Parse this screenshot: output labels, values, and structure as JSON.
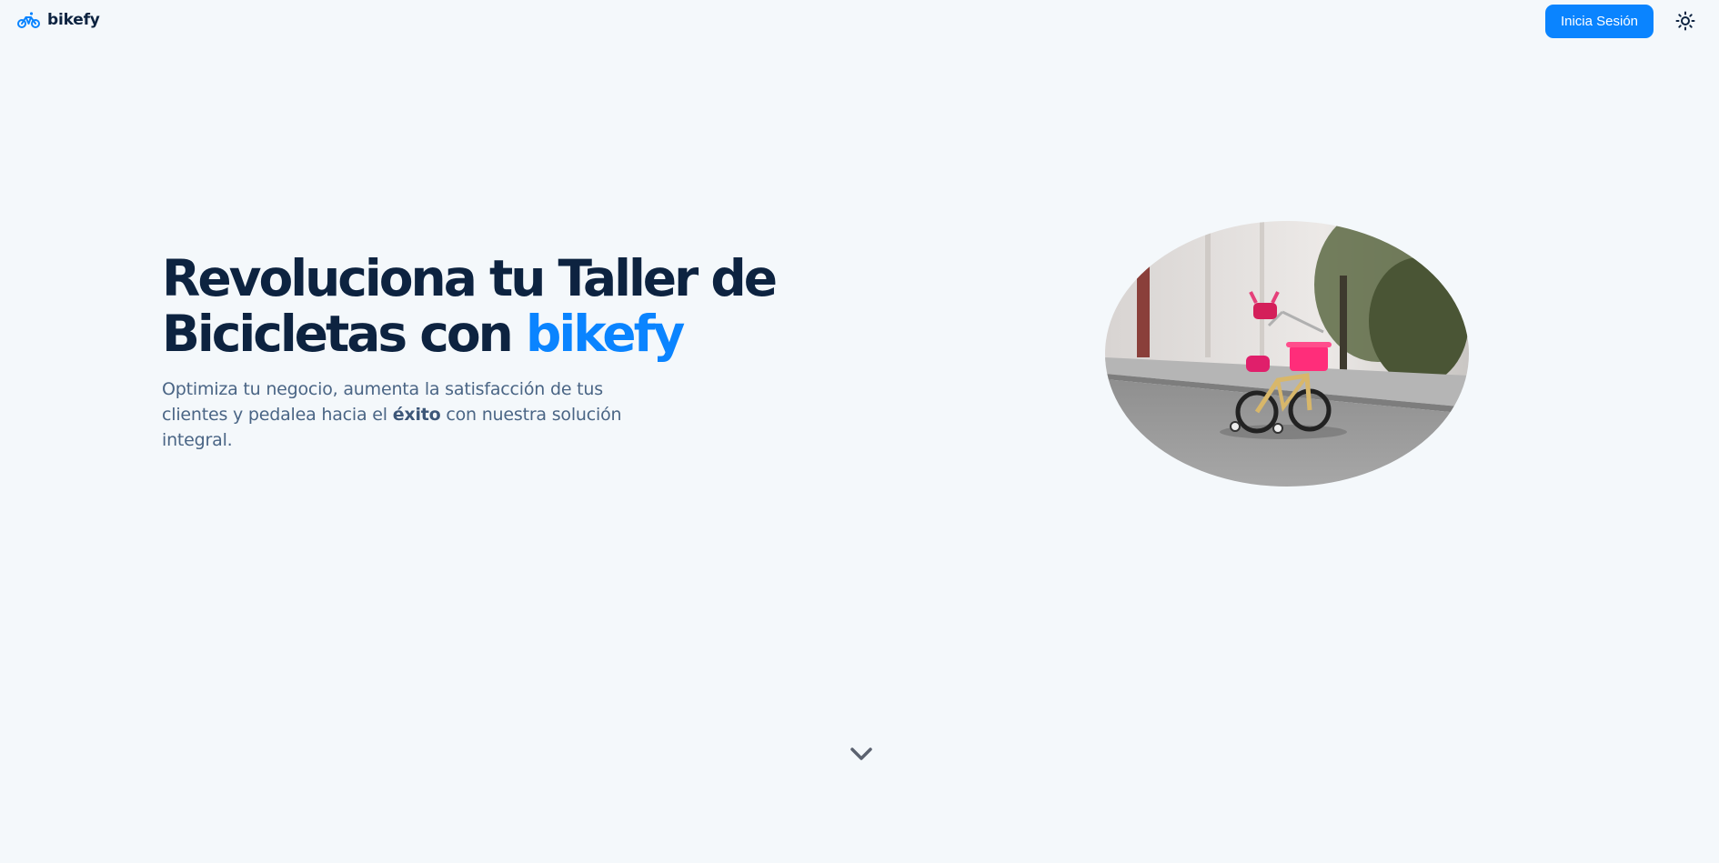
{
  "header": {
    "brand_name": "bikefy",
    "brand_icon": "bicycle-icon",
    "login_label": "Inicia Sesión",
    "theme_icon": "sun-icon"
  },
  "hero": {
    "title_line1": "Revoluciona tu Taller de",
    "title_line2_prefix": "Bicicletas con ",
    "title_accent": "bikefy",
    "subtitle_before": "Optimiza tu negocio, aumenta la satisfacción de tus clientes y pedalea hacia el ",
    "subtitle_bold": "éxito",
    "subtitle_after": " con nuestra solución integral.",
    "image": "child-bicycle-with-training-wheels-on-street"
  },
  "scroll": {
    "icon": "chevron-down-icon"
  },
  "colors": {
    "background": "#f4f8fb",
    "primary": "#0a84ff",
    "heading": "#0d2340",
    "body_text": "#4a6585"
  }
}
